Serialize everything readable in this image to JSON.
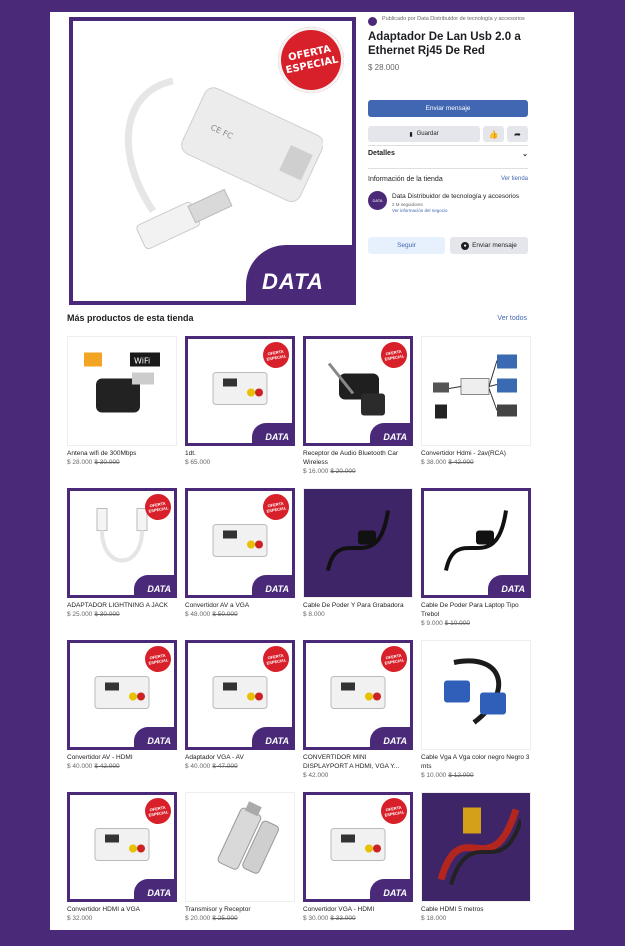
{
  "hero": {
    "ribbon_line1": "OFERTA",
    "ribbon_line2": "ESPECIAL",
    "logo_text": "DATA"
  },
  "listing": {
    "published_by": "Publicado por Data Distribuidor de tecnología y accesorios",
    "title": "Adaptador De Lan Usb 2.0 a Ethernet Rj45 De Red",
    "price": "$ 28.000",
    "send_message_label": "Enviar mensaje",
    "save_label": "Guardar",
    "details_label": "Detalles",
    "store_info_label": "Información de la tienda",
    "view_store_label": "Ver tienda",
    "store_name": "Data Distribuidor de tecnología y accesorios",
    "store_followers": "2 M seguidores",
    "store_more_info": "Ver información del negocio",
    "follow_label": "Seguir",
    "send_message2_label": "Enviar mensaje"
  },
  "more": {
    "title": "Más productos de esta tienda",
    "see_all": "Ver todos"
  },
  "products": [
    {
      "name": "Antena wifi de 300Mbps",
      "price": "$ 28.000",
      "old": "$ 30.000"
    },
    {
      "name": "1dt.",
      "price": "$ 65.000",
      "old": ""
    },
    {
      "name": "Receptor de Audio Bluetooth Car Wireless",
      "price": "$ 16.000",
      "old": "$ 20.000"
    },
    {
      "name": "Convertidor Hdmi - 2av(RCA)",
      "price": "$ 38.000",
      "old": "$ 42.000"
    },
    {
      "name": "ADAPTADOR LIGHTNING A JACK",
      "price": "$ 25.000",
      "old": "$ 30.000"
    },
    {
      "name": "Convertidor AV a VGA",
      "price": "$ 48.000",
      "old": "$ 50.000"
    },
    {
      "name": "Cable De Poder Y Para Grabadora",
      "price": "$ 8.000",
      "old": ""
    },
    {
      "name": "Cable De Poder Para Laptop Tipo Trebol",
      "price": "$ 9.000",
      "old": "$ 10.000"
    },
    {
      "name": "Convertidor AV - HDMI",
      "price": "$ 40.000",
      "old": "$ 42.000"
    },
    {
      "name": "Adaptador VGA - AV",
      "price": "$ 40.000",
      "old": "$ 47.000"
    },
    {
      "name": "CONVERTIDOR MINI DISPLAYPORT A HDMI, VGA Y...",
      "price": "$ 42.000",
      "old": ""
    },
    {
      "name": "Cable Vga A Vga color negro Negro 3 mts",
      "price": "$ 10.000",
      "old": "$ 12.000"
    },
    {
      "name": "Convertidor HDMI a VGA",
      "price": "$ 32.000",
      "old": ""
    },
    {
      "name": "Transmisor y Receptor",
      "price": "$ 20.000",
      "old": "$ 25.000"
    },
    {
      "name": "Convertidor VGA - HDMI",
      "price": "$ 30.000",
      "old": "$ 33.000"
    },
    {
      "name": "Cable HDMI 5 metros",
      "price": "$ 18.000",
      "old": ""
    }
  ],
  "badge": "OFERTA ESPECIAL",
  "mini_logo": "DATA",
  "colors": {
    "brand_purple": "#4a2a78",
    "badge_red": "#d8202a",
    "fb_blue": "#4267b2"
  }
}
